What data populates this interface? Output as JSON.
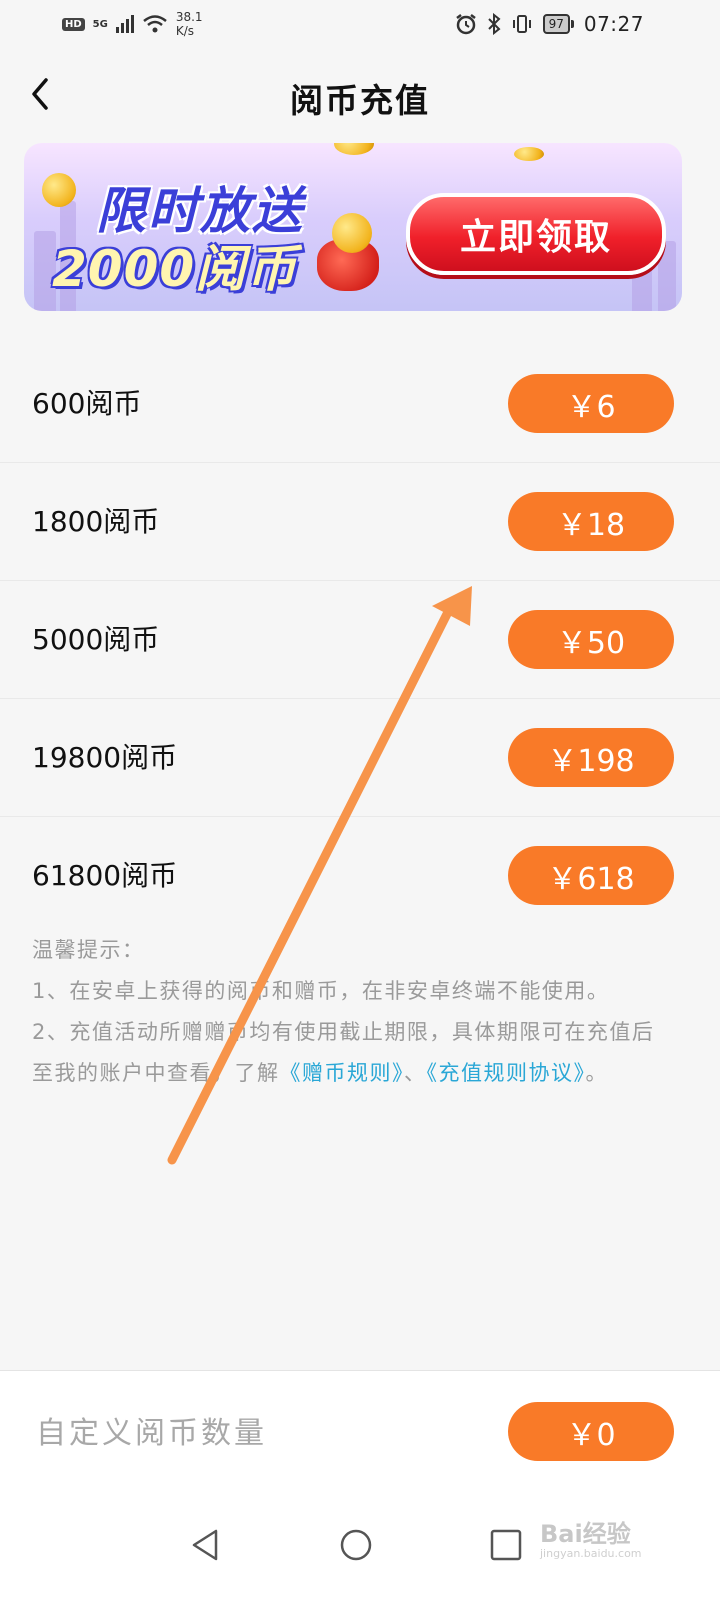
{
  "status_bar": {
    "hd": "HD",
    "signal": "5G",
    "net_speed_value": "38.1",
    "net_speed_unit": "K/s",
    "battery": "97",
    "time": "07:27"
  },
  "header": {
    "title": "阅币充值",
    "back_icon": "chevron-left-icon"
  },
  "banner": {
    "headline": "限时放送",
    "subline": "2000阅币",
    "cta": "立即领取"
  },
  "packages": [
    {
      "label": "600阅币",
      "price": "￥6"
    },
    {
      "label": "1800阅币",
      "price": "￥18"
    },
    {
      "label": "5000阅币",
      "price": "￥50"
    },
    {
      "label": "19800阅币",
      "price": "￥198"
    },
    {
      "label": "61800阅币",
      "price": "￥618"
    }
  ],
  "tips": {
    "heading": "温馨提示：",
    "line1": "1、在安卓上获得的阅币和赠币，在非安卓终端不能使用。",
    "line2": "2、充值活动所赠赠币均有使用截止期限，具体期限可在充值后至我的账户中查看，了解",
    "link1": "《赠币规则》",
    "sep": "、",
    "link2": "《充值规则协议》",
    "end": "。"
  },
  "custom": {
    "placeholder": "自定义阅币数量",
    "price": "￥0"
  },
  "nav": {
    "back": "triangle-back-icon",
    "home": "circle-home-icon",
    "recents": "square-recents-icon"
  },
  "watermark": {
    "text": "Bai经验",
    "sub": "jingyan.baidu.com"
  },
  "colors": {
    "accent": "#f97a28",
    "link": "#2aa7d6",
    "banner_button": "#f0202a"
  }
}
